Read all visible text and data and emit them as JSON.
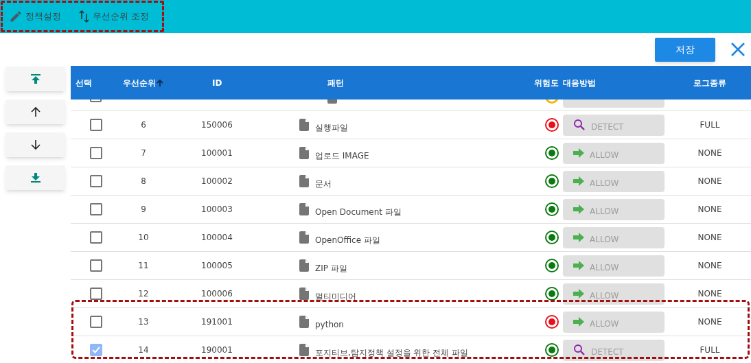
{
  "toolbar": {
    "items": [
      {
        "kind": "edit",
        "label": "정책설정"
      },
      {
        "kind": "sort",
        "label": "우선순위 조정"
      }
    ]
  },
  "save_button": "저장",
  "move_buttons": [
    {
      "kind": "top"
    },
    {
      "kind": "up"
    },
    {
      "kind": "down"
    },
    {
      "kind": "bottom"
    }
  ],
  "table": {
    "columns": [
      {
        "label": "선택",
        "sorted": false
      },
      {
        "label": "우선순위",
        "sorted": true
      },
      {
        "label": "ID",
        "sorted": false
      },
      {
        "label": "패턴",
        "sorted": false
      },
      {
        "label": "위험도",
        "sorted": false
      },
      {
        "label": "대응방법",
        "sorted": false
      },
      {
        "label": "로그종류",
        "sorted": false
      }
    ],
    "partial_row": {
      "checked": false,
      "risk": {
        "color": "#f5b800"
      }
    },
    "rows": [
      {
        "checked": false,
        "priority": "6",
        "id": "150006",
        "pattern": "실행파일",
        "risk": {
          "color": "#e8101a"
        },
        "action": {
          "kind": "detect",
          "label": "DETECT"
        },
        "log": "FULL",
        "highlighted": false
      },
      {
        "checked": false,
        "priority": "7",
        "id": "100001",
        "pattern": "업로드 IMAGE",
        "risk": {
          "color": "#0b7a10"
        },
        "action": {
          "kind": "allow",
          "label": "ALLOW"
        },
        "log": "NONE",
        "highlighted": false
      },
      {
        "checked": false,
        "priority": "8",
        "id": "100002",
        "pattern": "문서",
        "risk": {
          "color": "#0b7a10"
        },
        "action": {
          "kind": "allow",
          "label": "ALLOW"
        },
        "log": "NONE",
        "highlighted": false
      },
      {
        "checked": false,
        "priority": "9",
        "id": "100003",
        "pattern": "Open Document 파일",
        "risk": {
          "color": "#0b7a10"
        },
        "action": {
          "kind": "allow",
          "label": "ALLOW"
        },
        "log": "NONE",
        "highlighted": false
      },
      {
        "checked": false,
        "priority": "10",
        "id": "100004",
        "pattern": "OpenOffice 파일",
        "risk": {
          "color": "#0b7a10"
        },
        "action": {
          "kind": "allow",
          "label": "ALLOW"
        },
        "log": "NONE",
        "highlighted": false
      },
      {
        "checked": false,
        "priority": "11",
        "id": "100005",
        "pattern": "ZIP 파일",
        "risk": {
          "color": "#0b7a10"
        },
        "action": {
          "kind": "allow",
          "label": "ALLOW"
        },
        "log": "NONE",
        "highlighted": false
      },
      {
        "checked": false,
        "priority": "12",
        "id": "100006",
        "pattern": "멀티미디어",
        "risk": {
          "color": "#0b7a10"
        },
        "action": {
          "kind": "allow",
          "label": "ALLOW"
        },
        "log": "NONE",
        "highlighted": false
      },
      {
        "checked": false,
        "priority": "13",
        "id": "191001",
        "pattern": "python",
        "risk": {
          "color": "#e8101a"
        },
        "action": {
          "kind": "allow",
          "label": "ALLOW"
        },
        "log": "NONE",
        "highlighted": true
      },
      {
        "checked": true,
        "priority": "14",
        "id": "190001",
        "pattern": "포지티브,탐지정책 설정을 위한 전체 파일",
        "risk": {
          "color": "#0b7a10"
        },
        "action": {
          "kind": "detect",
          "label": "DETECT"
        },
        "log": "FULL",
        "highlighted": true
      }
    ]
  }
}
